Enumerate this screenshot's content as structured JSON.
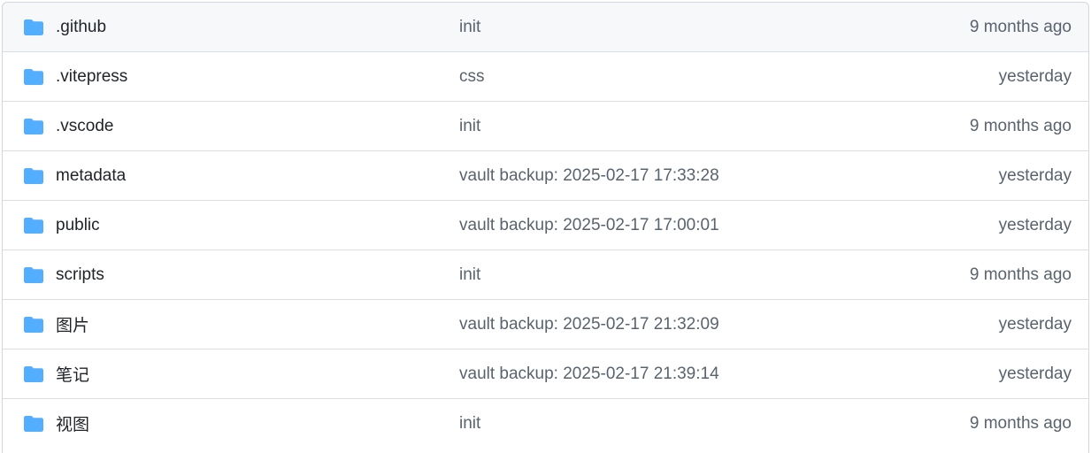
{
  "colors": {
    "folder": "#54aeff",
    "name_text": "#1f2328",
    "muted_text": "#59636e",
    "border": "#d0d7de",
    "header_bg": "#f6f8fa"
  },
  "files": [
    {
      "icon": "folder-icon",
      "name": ".github",
      "commit": "init",
      "age": "9 months ago"
    },
    {
      "icon": "folder-icon",
      "name": ".vitepress",
      "commit": "css",
      "age": "yesterday"
    },
    {
      "icon": "folder-icon",
      "name": ".vscode",
      "commit": "init",
      "age": "9 months ago"
    },
    {
      "icon": "folder-icon",
      "name": "metadata",
      "commit": "vault backup: 2025-02-17 17:33:28",
      "age": "yesterday"
    },
    {
      "icon": "folder-icon",
      "name": "public",
      "commit": "vault backup: 2025-02-17 17:00:01",
      "age": "yesterday"
    },
    {
      "icon": "folder-icon",
      "name": "scripts",
      "commit": "init",
      "age": "9 months ago"
    },
    {
      "icon": "folder-icon",
      "name": "图片",
      "commit": "vault backup: 2025-02-17 21:32:09",
      "age": "yesterday"
    },
    {
      "icon": "folder-icon",
      "name": "笔记",
      "commit": "vault backup: 2025-02-17 21:39:14",
      "age": "yesterday"
    },
    {
      "icon": "folder-icon",
      "name": "视图",
      "commit": "init",
      "age": "9 months ago"
    }
  ]
}
